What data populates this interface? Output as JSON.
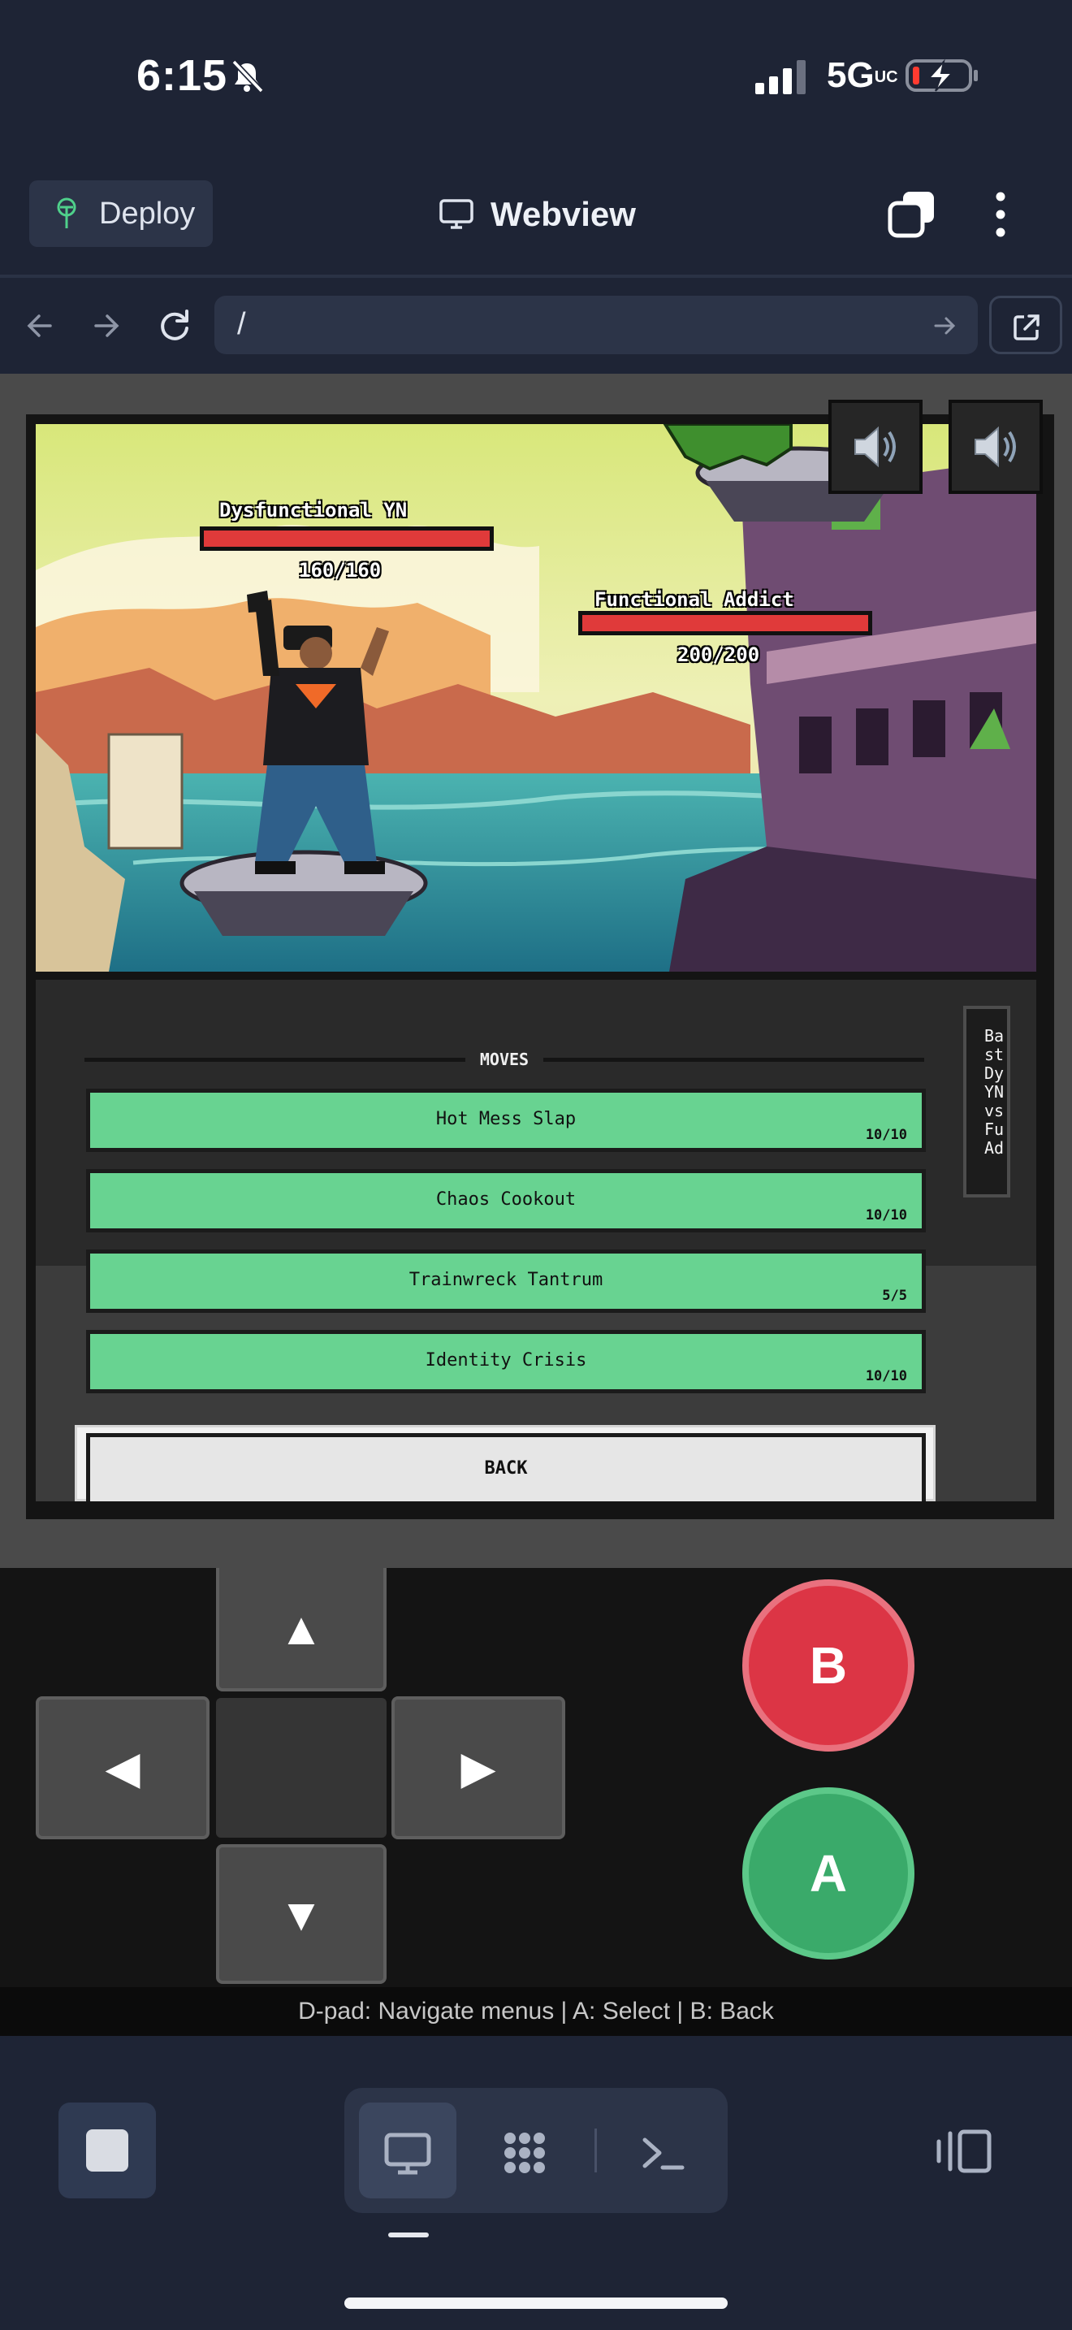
{
  "status_bar": {
    "time": "6:15",
    "network": "5G",
    "network_sub": "UC"
  },
  "header": {
    "deploy_label": "Deploy",
    "title": "Webview"
  },
  "url_bar": {
    "value": "/"
  },
  "game": {
    "player": {
      "name": "Dysfunctional YN",
      "hp": "160/160",
      "hp_fraction": 1.0
    },
    "opponent": {
      "name": "Functional Addict",
      "hp": "200/200",
      "hp_fraction": 1.0
    },
    "moves_title": "MOVES",
    "moves": [
      {
        "name": "Hot Mess Slap",
        "pp": "10/10"
      },
      {
        "name": "Chaos Cookout",
        "pp": "10/10"
      },
      {
        "name": "Trainwreck Tantrum",
        "pp": "5/5"
      },
      {
        "name": "Identity Crisis",
        "pp": "10/10"
      }
    ],
    "back_label": "BACK",
    "log_text": "Ba\nst\nDy\nYN\nvs\nFu\nAd"
  },
  "controller": {
    "up": "▲",
    "down": "▼",
    "left": "◀",
    "right": "▶",
    "b_label": "B",
    "a_label": "A",
    "help": "D-pad: Navigate menus | A: Select | B: Back"
  },
  "colors": {
    "move_button": "#68d391",
    "hp_bar": "#e03a3a",
    "b_button": "#dc3545",
    "a_button": "#3aaa6a",
    "app_bg": "#1e2435"
  }
}
